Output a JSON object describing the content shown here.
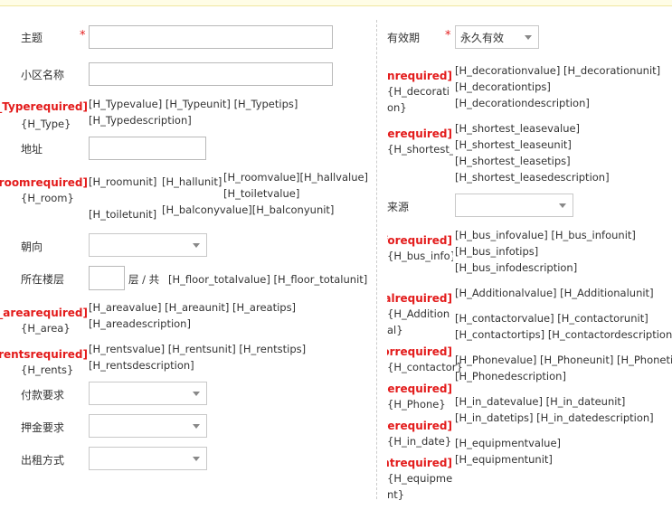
{
  "left": {
    "subject_label": "主题",
    "required_star": "*",
    "community_label": "小区名称",
    "type_required": "[H_Typerequired]",
    "type_line1": "[H_Typevalue] [H_Typeunit] [H_Typetips]",
    "type_line2": "[H_Typedescription]",
    "type_ph": "{H_Type}",
    "address_label": "地址",
    "room_required": "[H_roomrequired]",
    "room_ph": "{H_room}",
    "room_unit": "[H_roomunit]",
    "hall_unit": "[H_hallunit]",
    "room_hall_value": "[H_roomvalue][H_hallvalue]",
    "toilet_value": "[H_toiletvalue]",
    "toilet_unit": "[H_toiletunit]",
    "balcony": "[H_balconyvalue][H_balconyunit]",
    "orientation_label": "朝向",
    "floor_label": "所在楼层",
    "floor_sep": "层 / 共",
    "floor_total": "[H_floor_totalvalue] [H_floor_totalunit]",
    "area_required": "[H_arearequired]",
    "area_ph": "{H_area}",
    "area_line1": "[H_areavalue] [H_areaunit] [H_areatips]",
    "area_line2": "[H_areadescription]",
    "rents_required": "[H_rentsrequired]",
    "rents_ph": "{H_rents}",
    "rents_line1": "[H_rentsvalue] [H_rentsunit] [H_rentstips]",
    "rents_line2": "[H_rentsdescription]",
    "payment_label": "付款要求",
    "deposit_label": "押金要求",
    "rental_label": "出租方式"
  },
  "right": {
    "validity_label": "有效期",
    "validity_value": "永久有效",
    "decoration_required": "[H_decorationrequired]",
    "decoration_ph": "{H_decoration}",
    "decoration_line1": "[H_decorationvalue] [H_decorationunit]",
    "decoration_line2": "[H_decorationtips]",
    "decoration_line3": "[H_decorationdescription]",
    "shortest_required": "[H_shortest_leaserequired]",
    "shortest_ph": "{H_shortest_lease}",
    "shortest_line1": "[H_shortest_leasevalue]",
    "shortest_line2": "[H_shortest_leaseunit]",
    "shortest_line3": "[H_shortest_leasetips]",
    "shortest_line4": "[H_shortest_leasedescription]",
    "source_label": "来源",
    "bus_required": "[H_bus_inforequired]",
    "bus_ph": "{H_bus_info}",
    "bus_line1": "[H_bus_infovalue] [H_bus_infounit]",
    "bus_line2": "[H_bus_infotips]",
    "bus_line3": "[H_bus_infodescription]",
    "additional_required": "[H_Additionalrequired]",
    "additional_ph": "{H_Additional}",
    "additional_line1": "[H_Additionalvalue] [H_Additionalunit]",
    "contactor_required": "[H_contactorrequired]",
    "contactor_ph": "{H_contactor}",
    "contactor_line1": "[H_contactorvalue] [H_contactorunit]",
    "contactor_line2": "[H_contactortips] [H_contactordescription]",
    "phone_required": "[H_Phonerequired]",
    "phone_ph": "{H_Phone}",
    "phone_line1": "[H_Phonevalue] [H_Phoneunit] [H_Phonetips]",
    "phone_line2": "[H_Phonedescription]",
    "indate_required": "[H_in_daterequired]",
    "indate_ph": "{H_in_date}",
    "indate_line1": "[H_in_datevalue] [H_in_dateunit]",
    "indate_line2": "[H_in_datetips] [H_in_datedescription]",
    "equipment_required": "[H_equipmentrequired]",
    "equipment_ph": "{H_equipment}",
    "equipment_line1": "[H_equipmentvalue]",
    "equipment_line2": "[H_equipmentunit]"
  }
}
